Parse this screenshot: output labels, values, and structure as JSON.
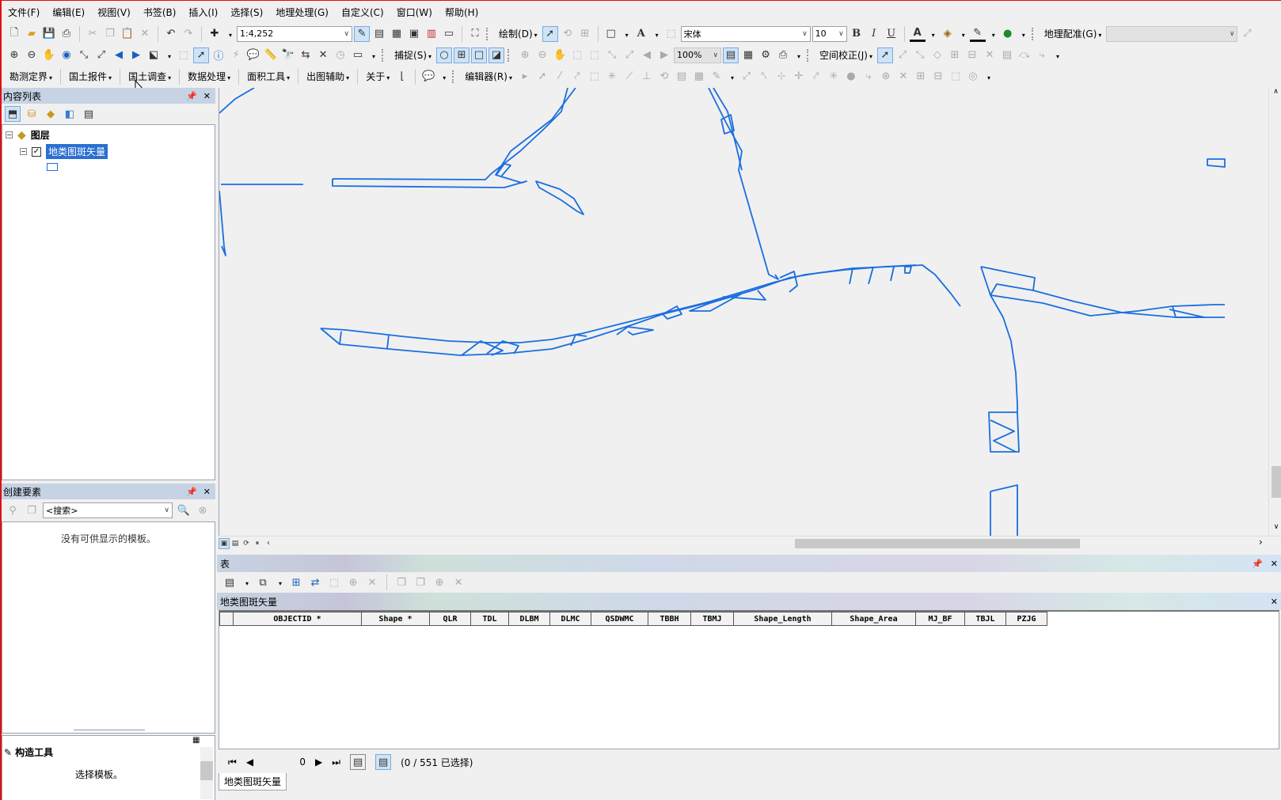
{
  "menu": [
    "文件(F)",
    "编辑(E)",
    "视图(V)",
    "书签(B)",
    "插入(I)",
    "选择(S)",
    "地理处理(G)",
    "自定义(C)",
    "窗口(W)",
    "帮助(H)"
  ],
  "toolbar1": {
    "scale": "1:4,252",
    "draw_label": "绘制(D)",
    "font_name": "宋体",
    "font_size": "10",
    "bold": "B",
    "italic": "I",
    "underline": "U",
    "georef_label": "地理配准(G)"
  },
  "toolbar2": {
    "snap_label": "捕捉(S)",
    "zoom_level": "100%",
    "spatial_adjust_label": "空间校正(J)"
  },
  "toolbar3": {
    "items": [
      "勘测定界",
      "国土报件",
      "国土调查",
      "数据处理",
      "面积工具",
      "出图辅助",
      "关于"
    ],
    "editor_label": "编辑器(R)"
  },
  "toc": {
    "title": "内容列表",
    "layers_root": "图层",
    "layer_name": "地类图斑矢量"
  },
  "create_features": {
    "title": "创建要素",
    "search_placeholder": "<搜索>",
    "empty_message": "没有可供显示的模板。"
  },
  "construct_tools": {
    "title": "构造工具",
    "message": "选择模板。"
  },
  "table": {
    "window_title": "表",
    "layer_title": "地类图斑矢量",
    "columns": [
      "OBJECTID *",
      "Shape *",
      "QLR",
      "TDL",
      "DLBM",
      "DLMC",
      "QSDWMC",
      "TBBH",
      "TBMJ",
      "Shape_Length",
      "Shape_Area",
      "MJ_BF",
      "TBJL",
      "PZJG"
    ],
    "record_index": "0",
    "selection_status": "(0 / 551 已选择)",
    "tab_label": "地类图斑矢量"
  },
  "colors": {
    "feature_stroke": "#1a6ee0",
    "selection_highlight": "#2a6fd1",
    "panel_header": "#c5d3e4"
  }
}
